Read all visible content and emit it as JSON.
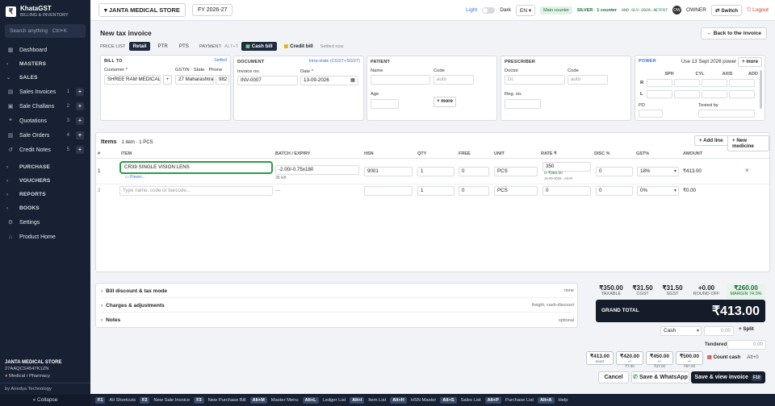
{
  "app": {
    "name": "KhataGST",
    "subtitle": "BILLING & INVENTORY",
    "logo": "₹"
  },
  "sidebar": {
    "search_placeholder": "Search anything",
    "search_shortcut": "Ctrl+K",
    "dashboard": "Dashboard",
    "masters": "MASTERS",
    "sales": "SALES",
    "sales_items": [
      {
        "label": "Sales Invoices",
        "count": "1"
      },
      {
        "label": "Sale Challans",
        "count": "2"
      },
      {
        "label": "Quotations",
        "count": "3"
      },
      {
        "label": "Sale Orders",
        "count": "4"
      },
      {
        "label": "Credit Notes",
        "count": "5"
      }
    ],
    "purchase": "PURCHASE",
    "vouchers": "VOUCHERS",
    "reports": "REPORTS",
    "books": "BOOKS",
    "settings": "Settings",
    "product_home": "Product Home",
    "store_name": "JANTA MEDICAL STORE",
    "store_gstin": "27AAQCS4547K1ZN",
    "store_type": "Medical / Pharmacy",
    "by": "by Anedya Technology",
    "collapse": "« Collapse"
  },
  "topbar": {
    "store": "JANTA MEDICAL STORE",
    "fy": "FY 2026-27",
    "light": "Light",
    "dark": "Dark",
    "lang": "EN",
    "counter": "Main counter",
    "plan": "SILVER · 1 counter",
    "license": "ANO-SLV-2026-4E7F07",
    "avatar": "OW",
    "role": "OWNER",
    "switch": "Switch",
    "logout": "Logout"
  },
  "invoice": {
    "title": "New tax invoice",
    "back": "Back to the invoice",
    "price_list_label": "PRICE LIST",
    "price_tabs": [
      "Retail",
      "PTR",
      "PTS"
    ],
    "payment_label": "PAYMENT",
    "payment_shortcut": "ALT+T",
    "cash_bill": "Cash bill",
    "credit_bill": "Credit bill",
    "settled": "Settled now"
  },
  "bill_to": {
    "title": "BILL TO",
    "status": "Settled",
    "customer_label": "Customer *",
    "customer": "SHREE RAM MEDICAL",
    "gstin_label": "GSTIN · State · Phone",
    "state": "27 Maharashtra",
    "phone": "982"
  },
  "document": {
    "title": "DOCUMENT",
    "tax_type": "Intra-state (CGST+SGST)",
    "invoice_no_label": "Invoice no.",
    "invoice_no": "INV-0007",
    "date_label": "Date *",
    "date": "13-09-2026"
  },
  "patient": {
    "title": "PATIENT",
    "name_label": "Name",
    "code_label": "Code",
    "code_ph": "auto",
    "age_label": "Age",
    "more": "+ more"
  },
  "prescriber": {
    "title": "PRESCRIBER",
    "doctor_label": "Doctor",
    "doctor_ph": "Dr.",
    "code_label": "Code",
    "code_ph": "auto",
    "reg_label": "Reg. no."
  },
  "power": {
    "title": "POWER",
    "use_label": "Use 13 Sept 2026 power",
    "more": "+ more",
    "cols": [
      "SPH",
      "CYL",
      "AXIS",
      "ADD"
    ],
    "rows": [
      "R",
      "L"
    ],
    "pd_label": "PD",
    "tested_label": "Tested by"
  },
  "items": {
    "title": "Items",
    "count": "1 item · 1 PCS",
    "add_line": "+ Add line",
    "new_medicine": "+ New medicine",
    "headers": [
      "#",
      "ITEM",
      "BATCH / EXPIRY",
      "HSN",
      "QTY",
      "FREE",
      "UNIT",
      "RATE ₹",
      "DISC %",
      "GST%",
      "AMOUNT"
    ],
    "rows": [
      {
        "num": "1",
        "item": "CR39 SINGLE VISION LENS",
        "sub": "Power...",
        "batch": "-2.00/-0.75x180",
        "left": "38 left",
        "hsn": "9001",
        "qty": "1",
        "free": "0",
        "unit": "PCS",
        "rate": "350",
        "rate_hint": "ct ₹350.00",
        "rate_hint2": "15-09-2026 · Alt+R",
        "disc": "0",
        "gst": "18%",
        "amount": "₹413.00"
      },
      {
        "num": "2",
        "item_ph": "Type name, code or barcode...",
        "batch": "—",
        "hsn": "",
        "qty": "1",
        "free": "0",
        "unit": "PCS",
        "rate": "0",
        "disc": "0",
        "gst": "0%",
        "amount": "₹0.00"
      }
    ]
  },
  "summary": {
    "discount": "Bill discount & tax mode",
    "discount_right": "none",
    "charges": "Charges & adjustments",
    "charges_right": "freight, cash-discount",
    "notes": "Notes",
    "notes_right": "optional"
  },
  "totals": [
    {
      "value": "₹350.00",
      "label": "TAXABLE"
    },
    {
      "value": "₹31.50",
      "label": "CGST"
    },
    {
      "value": "₹31.50",
      "label": "SGST"
    },
    {
      "value": "+0.00",
      "label": "ROUND OFF"
    },
    {
      "value": "₹260.00",
      "label": "MARGIN 74.3%"
    }
  ],
  "grand": {
    "label": "GRAND TOTAL",
    "value": "₹413.00"
  },
  "payment": {
    "mode": "Cash",
    "amount": "0.00",
    "split": "+ Split",
    "tendered_label": "Tendered",
    "tendered": "0.00",
    "quick": [
      {
        "v": "₹413.00",
        "s": "exact"
      },
      {
        "v": "₹420.00",
        "s": "₹7.00"
      },
      {
        "v": "₹450.00",
        "s": "₹37.00"
      },
      {
        "v": "₹500.00",
        "s": "₹87.00"
      }
    ],
    "count_cash": "Count cash",
    "count_key": "Alt+0"
  },
  "actions": {
    "cancel": "Cancel",
    "whatsapp": "Save & WhatsApp",
    "save": "Save & view invoice",
    "save_key": "F10"
  },
  "shortcuts": [
    {
      "k": "F1",
      "l": "All Shortcuts"
    },
    {
      "k": "F2",
      "l": "New Sale Invoice"
    },
    {
      "k": "F3",
      "l": "New Purchase Bill"
    },
    {
      "k": "Alt+M",
      "l": "Master Menu"
    },
    {
      "k": "Alt+L",
      "l": "Ledger List"
    },
    {
      "k": "Alt+I",
      "l": "Item List"
    },
    {
      "k": "Alt+H",
      "l": "HSN Master"
    },
    {
      "k": "Alt+S",
      "l": "Sales List"
    },
    {
      "k": "Alt+P",
      "l": "Purchase List"
    },
    {
      "k": "Alt+A",
      "l": "Help"
    }
  ],
  "colors": {
    "sidebar": "#182133",
    "accent": "#1e2a3d",
    "green_focus": "#2e9a48",
    "danger": "#c0392b"
  }
}
